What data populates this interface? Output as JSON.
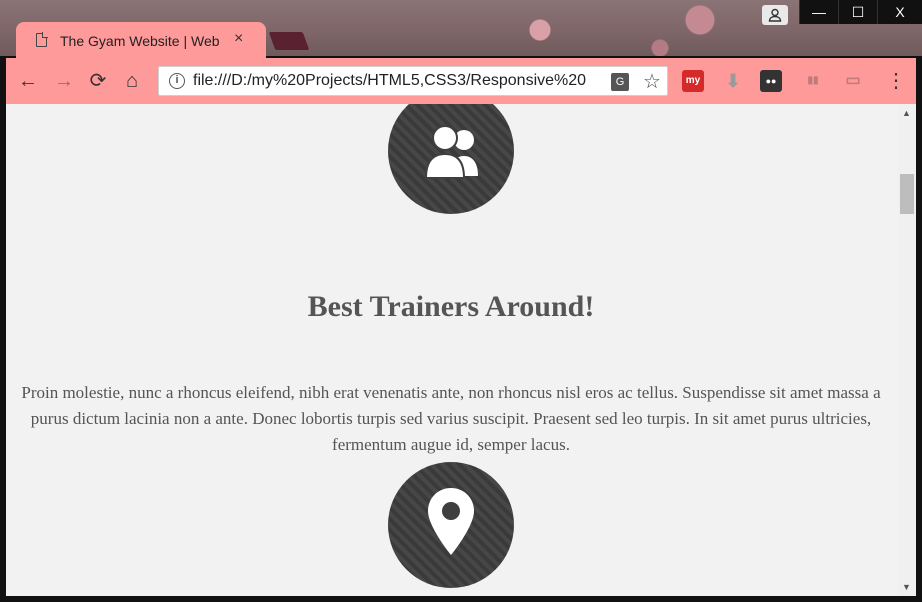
{
  "browser": {
    "tab": {
      "title": "The Gyam Website | Web",
      "close": "×"
    },
    "profile_icon": "person-icon",
    "window_buttons": {
      "minimize": "—",
      "maximize": "☐",
      "close": "X"
    },
    "nav": {
      "back": "←",
      "forward": "→",
      "reload": "⟳",
      "home": "⌂"
    },
    "url": "file:///D:/my%20Projects/HTML5,CSS3/Responsive%20",
    "info_icon": "i",
    "translate_icon": "G",
    "star_icon": "☆",
    "extensions": [
      {
        "name": "my-extension-icon",
        "label": "my",
        "color": "#d42a2a"
      },
      {
        "name": "download-extension-icon",
        "label": "⬇",
        "color": "#9a9a9a"
      },
      {
        "name": "glasses-extension-icon",
        "label": "●●",
        "color": "#333333"
      },
      {
        "name": "chart-extension-icon",
        "label": "▮▮",
        "color": "#c9a0a0"
      },
      {
        "name": "cast-extension-icon",
        "label": "▭",
        "color": "#c9a0a0"
      }
    ],
    "menu_icon": "⋮"
  },
  "page": {
    "heading": "Best Trainers Around!",
    "paragraph": "Proin molestie, nunc a rhoncus eleifend, nibh erat venenatis ante, non rhoncus nisl eros ac tellus. Suspendisse sit amet massa a purus dictum lacinia non a ante. Donec lobortis turpis sed varius suscipit. Praesent sed leo turpis. In sit amet purus ultricies, fermentum augue id, semper lacus.",
    "icons": [
      "users-icon",
      "map-marker-icon"
    ]
  },
  "scrollbar": {
    "up": "▲",
    "down": "▼"
  },
  "colors": {
    "chrome_pink": "#ff9a9a",
    "page_bg": "#f2f2f2",
    "circle": "#3f3f3f",
    "text": "#555555"
  }
}
